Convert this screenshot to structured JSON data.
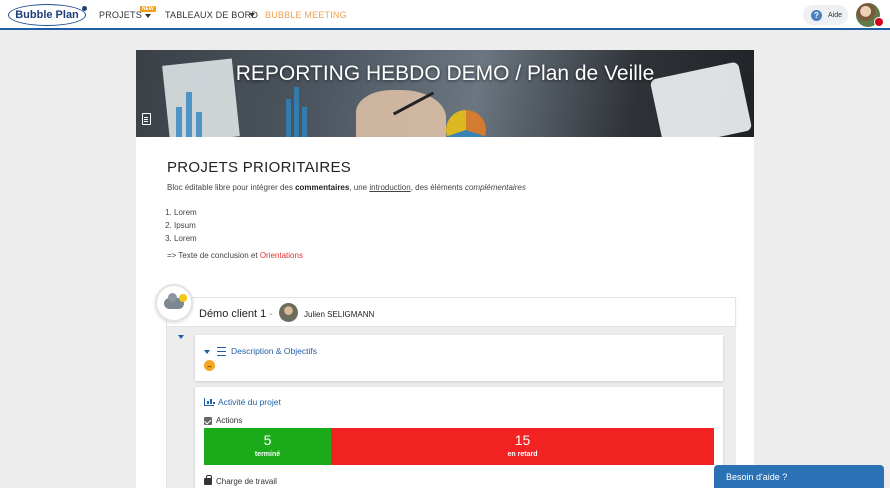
{
  "nav": {
    "logo_text": "Bubble Plan",
    "items": [
      {
        "label": "PROJETS",
        "badge": "NEW"
      },
      {
        "label": "TABLEAUX DE BORD"
      },
      {
        "label": "BUBBLE MEETING"
      }
    ],
    "help_label": "Aide",
    "accent_color": "#1f5fa6",
    "meeting_color": "#f0a04b"
  },
  "report": {
    "banner_title": "REPORTING HEBDO DEMO / Plan de Veille",
    "section_title": "PROJETS PRIORITAIRES",
    "intro": {
      "prefix": "Bloc éditable libre pour intégrer des ",
      "bold": "commentaires",
      "mid": ", une ",
      "underline": "introduction",
      "mid2": ", des éléments ",
      "italic": "complémentaires"
    },
    "list": [
      "Lorem",
      "Ipsum",
      "Lorem"
    ],
    "conclusion_prefix": "=> Texte de conclusion et ",
    "conclusion_red": "Orientations"
  },
  "project": {
    "name": "Démo client 1",
    "separator": "-",
    "owner": "Julien SELIGMANN",
    "weather_icon": "cloudy-sun-icon",
    "description_title": "Description & Objectifs",
    "activity_title": "Activité du projet",
    "actions_label": "Actions",
    "stats": [
      {
        "value": "5",
        "label": "terminé",
        "color": "#1aaa1a"
      },
      {
        "value": "15",
        "label": "en retard",
        "color": "#f22222"
      }
    ],
    "workload_label": "Charge de travail"
  },
  "chat": {
    "label": "Besoin d'aide ?"
  }
}
